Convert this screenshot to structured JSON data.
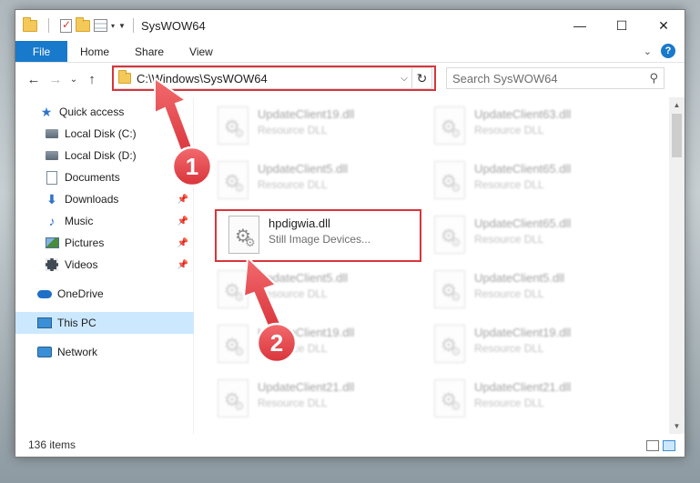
{
  "window": {
    "title": "SysWOW64"
  },
  "ribbon": {
    "tabs": [
      "File",
      "Home",
      "Share",
      "View"
    ]
  },
  "address": {
    "path": "C:\\Windows\\SysWOW64"
  },
  "search": {
    "placeholder": "Search SysWOW64"
  },
  "nav": {
    "items": [
      {
        "label": "Quick access"
      },
      {
        "label": "Local Disk (C:)"
      },
      {
        "label": "Local Disk (D:)"
      },
      {
        "label": "Documents"
      },
      {
        "label": "Downloads"
      },
      {
        "label": "Music"
      },
      {
        "label": "Pictures"
      },
      {
        "label": "Videos"
      },
      {
        "label": "OneDrive"
      },
      {
        "label": "This PC"
      },
      {
        "label": "Network"
      }
    ]
  },
  "files": [
    {
      "name": "UpdateClient19.dll",
      "type": "Resource DLL"
    },
    {
      "name": "UpdateClient63.dll",
      "type": "Resource DLL"
    },
    {
      "name": "UpdateClient5.dll",
      "type": "Resource DLL"
    },
    {
      "name": "UpdateClient65.dll",
      "type": "Resource DLL"
    },
    {
      "name": "hpdigwia.dll",
      "type": "Still Image Devices..."
    },
    {
      "name": "UpdateClient65.dll",
      "type": "Resource DLL"
    },
    {
      "name": "UpdateClient5.dll",
      "type": "Resource DLL"
    },
    {
      "name": "UpdateClient5.dll",
      "type": "Resource DLL"
    },
    {
      "name": "UpdateClient19.dll",
      "type": "Resource DLL"
    },
    {
      "name": "UpdateClient19.dll",
      "type": "Resource DLL"
    },
    {
      "name": "UpdateClient21.dll",
      "type": "Resource DLL"
    },
    {
      "name": "UpdateClient21.dll",
      "type": "Resource DLL"
    }
  ],
  "status": {
    "item_count": "136 items"
  },
  "annotations": {
    "step1": "1",
    "step2": "2"
  },
  "colors": {
    "accent": "#1979ca",
    "highlight": "#d9343b",
    "selection": "#cce8ff"
  }
}
